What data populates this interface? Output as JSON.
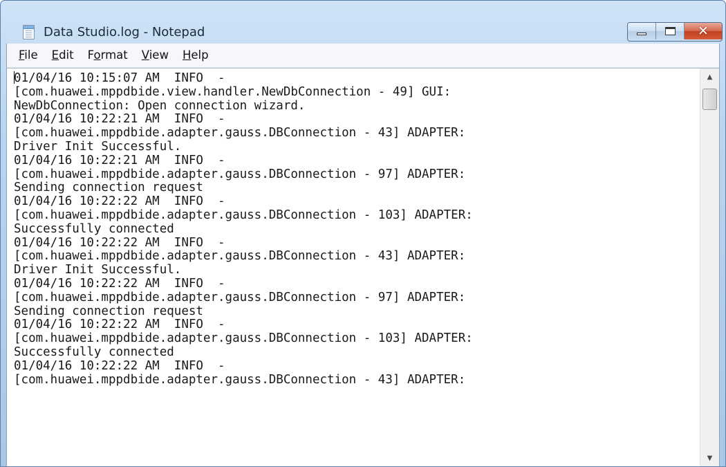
{
  "window": {
    "title": "Data Studio.log - Notepad",
    "app_icon": "notepad-icon",
    "caption_buttons": {
      "minimize_icon": "minimize-icon",
      "maximize_icon": "maximize-icon",
      "close_icon": "close-icon",
      "close_glyph": "✕",
      "close_color": "#c2401f"
    }
  },
  "menu": {
    "items": [
      {
        "pre": "",
        "u": "F",
        "post": "ile"
      },
      {
        "pre": "",
        "u": "E",
        "post": "dit"
      },
      {
        "pre": "F",
        "u": "o",
        "post": "rmat"
      },
      {
        "pre": "",
        "u": "V",
        "post": "iew"
      },
      {
        "pre": "",
        "u": "H",
        "post": "elp"
      }
    ]
  },
  "editor": {
    "first_char": "0",
    "content_rest": "1/04/16 10:15:07 AM  INFO  -\n[com.huawei.mppdbide.view.handler.NewDbConnection - 49] GUI:\nNewDbConnection: Open connection wizard.\n01/04/16 10:22:21 AM  INFO  -\n[com.huawei.mppdbide.adapter.gauss.DBConnection - 43] ADAPTER:\nDriver Init Successful.\n01/04/16 10:22:21 AM  INFO  -\n[com.huawei.mppdbide.adapter.gauss.DBConnection - 97] ADAPTER:\nSending connection request\n01/04/16 10:22:22 AM  INFO  -\n[com.huawei.mppdbide.adapter.gauss.DBConnection - 103] ADAPTER:\nSuccessfully connected\n01/04/16 10:22:22 AM  INFO  -\n[com.huawei.mppdbide.adapter.gauss.DBConnection - 43] ADAPTER:\nDriver Init Successful.\n01/04/16 10:22:22 AM  INFO  -\n[com.huawei.mppdbide.adapter.gauss.DBConnection - 97] ADAPTER:\nSending connection request\n01/04/16 10:22:22 AM  INFO  -\n[com.huawei.mppdbide.adapter.gauss.DBConnection - 103] ADAPTER:\nSuccessfully connected\n01/04/16 10:22:22 AM  INFO  -\n[com.huawei.mppdbide.adapter.gauss.DBConnection - 43] ADAPTER:"
  },
  "scrollbar": {
    "up_icon": "scroll-up-arrow-icon",
    "down_icon": "scroll-down-arrow-icon",
    "up_glyph": "▲",
    "down_glyph": "▼"
  }
}
